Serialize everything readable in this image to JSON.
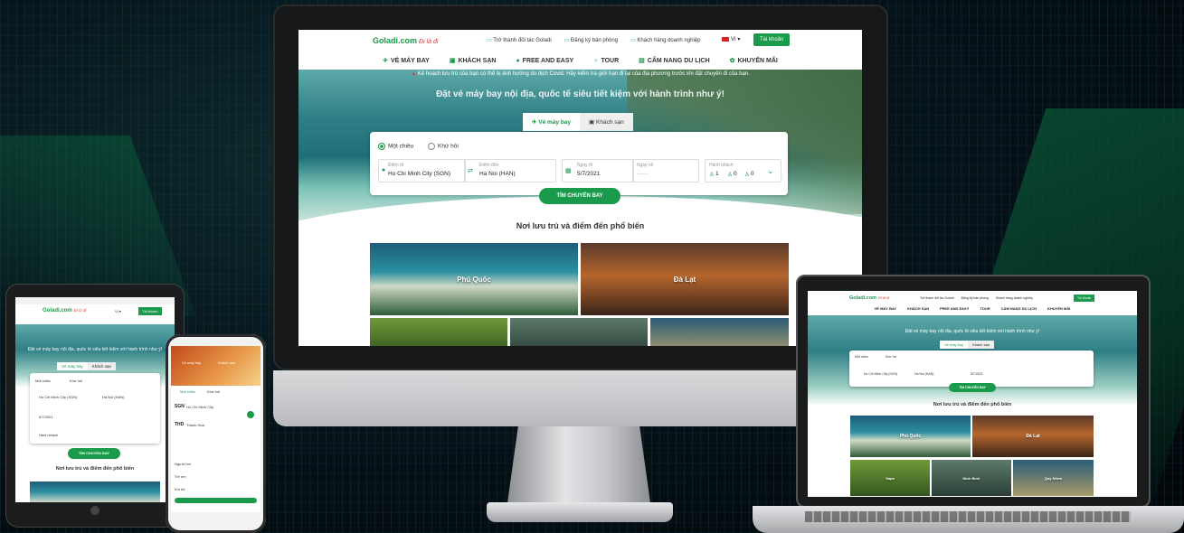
{
  "site": {
    "logo": "Goladi.com",
    "logo_slogan": "Đi là đi",
    "header_links": [
      "Trở thành đối tác Goladi",
      "Đăng ký bán phòng",
      "Khách hàng doanh nghiệp"
    ],
    "language": "VI",
    "account_button": "Tài khoản"
  },
  "nav": {
    "items": [
      {
        "label": "VÉ MÁY BAY",
        "icon": "plane-icon"
      },
      {
        "label": "KHÁCH SẠN",
        "icon": "hotel-icon"
      },
      {
        "label": "FREE AND EASY",
        "icon": "globe-icon"
      },
      {
        "label": "TOUR",
        "icon": "palm-icon"
      },
      {
        "label": "CẨM NANG DU LỊCH",
        "icon": "book-icon"
      },
      {
        "label": "KHUYẾN MÃI",
        "icon": "gift-icon"
      }
    ]
  },
  "hero": {
    "covid_notice": "Kế hoạch lưu trú của bạn có thể bị ảnh hưởng do dịch Covid. Hãy kiểm tra giới hạn đi lại của địa phương trước khi đặt chuyến đi của bạn.",
    "title": "Đặt vé máy bay nội địa, quốc tế siêu tiết kiệm với hành trình như ý!"
  },
  "search": {
    "tabs": [
      "Vé máy bay",
      "Khách sạn"
    ],
    "trip_types": [
      "Một chiều",
      "Khứ hồi"
    ],
    "from_label": "Điểm đi",
    "from_value": "Ho Chi Minh City (SGN)",
    "to_label": "Điểm đến",
    "to_value": "Ha Noi (HAN)",
    "depart_label": "Ngày đi",
    "depart_value": "5/7/2021",
    "return_label": "Ngày về",
    "return_value": "------",
    "pax_label": "Hành khách",
    "adults": "1",
    "children": "0",
    "infants": "0",
    "button": "TÌM CHUYẾN BAY"
  },
  "popular": {
    "title": "Nơi lưu trú và điểm đến phổ biến",
    "destinations": [
      "Phú Quốc",
      "Đà Lạt",
      "Sapa",
      "Ninh Bình",
      "Quy Nhơn"
    ]
  },
  "mobile": {
    "from_code": "SGN",
    "from_city": "Ho Chi Minh City",
    "to_code": "THD",
    "to_city": "Thanh Hóa",
    "pax_rows": [
      "Người lớn",
      "Trẻ em",
      "Em bé"
    ]
  }
}
